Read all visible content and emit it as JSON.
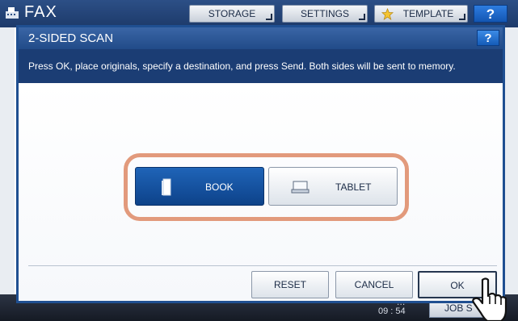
{
  "background": {
    "app_title": "FAX",
    "app_icon": "fax-icon",
    "tabs": [
      {
        "label": "STORAGE"
      },
      {
        "label": "SETTINGS"
      },
      {
        "label": "TEMPLATE",
        "icon": "star-icon"
      }
    ],
    "help_label": "?",
    "clock_date": "…",
    "clock_time": "09 : 54",
    "job_status_label": "JOB S"
  },
  "dialog": {
    "title": "2-SIDED SCAN",
    "help_label": "?",
    "message": "Press OK, place originals, specify a destination, and press Send. Both sides will be sent to memory.",
    "modes": [
      {
        "label": "BOOK",
        "icon": "book-icon",
        "selected": true
      },
      {
        "label": "TABLET",
        "icon": "tablet-icon",
        "selected": false
      }
    ],
    "highlight_color": "#e29a7c",
    "buttons": {
      "reset_label": "RESET",
      "cancel_label": "CANCEL",
      "ok_label": "OK"
    }
  },
  "cursor": "hand-pointer-icon"
}
